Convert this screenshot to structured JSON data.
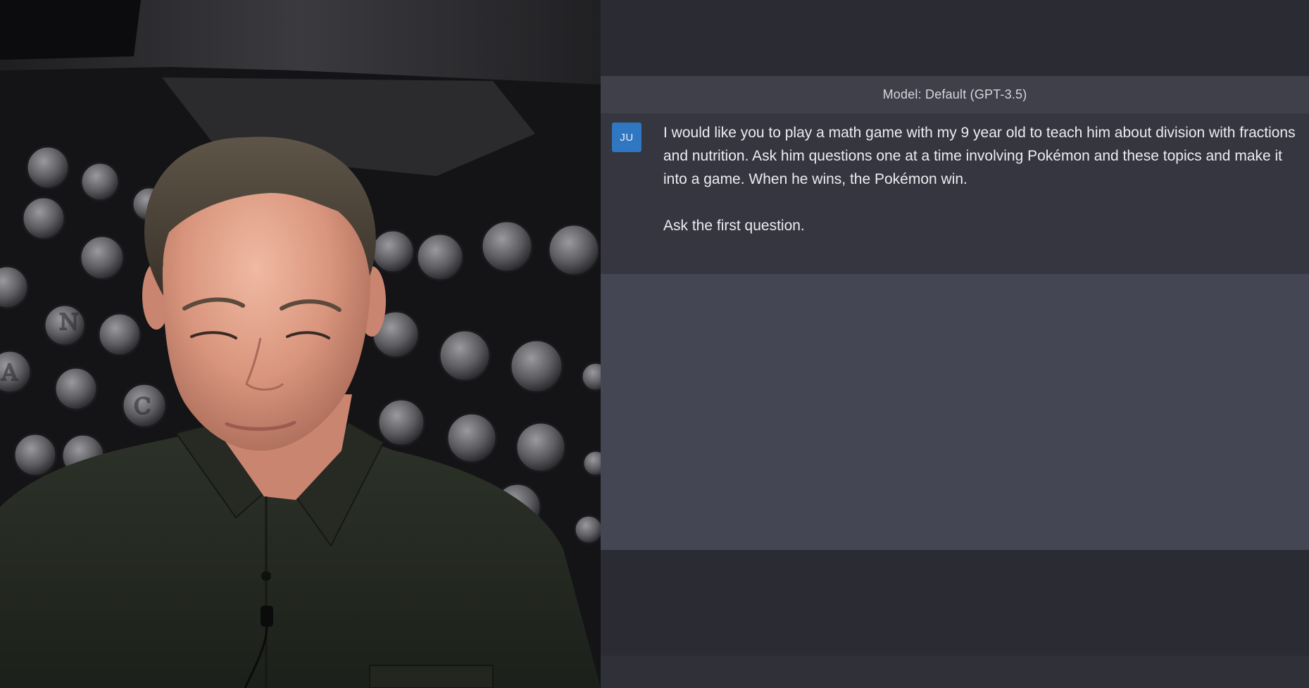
{
  "chat": {
    "model_label": "Model: Default (GPT-3.5)",
    "user_avatar_initials": "JU",
    "user_message": {
      "paragraph_1": "I would like you to play a math game with my 9 year old to teach him about division with fractions and nutrition. Ask him questions one at a time involving Pokémon and these topics and make it into a game. When he wins, the Pokémon win.",
      "paragraph_2": "Ask the first question."
    }
  },
  "colors": {
    "chat_background": "#2b2c33",
    "model_bar": "#3f404a",
    "user_message_bg": "#353640",
    "response_area_bg": "#444654",
    "avatar_bg": "#2f77c0"
  }
}
